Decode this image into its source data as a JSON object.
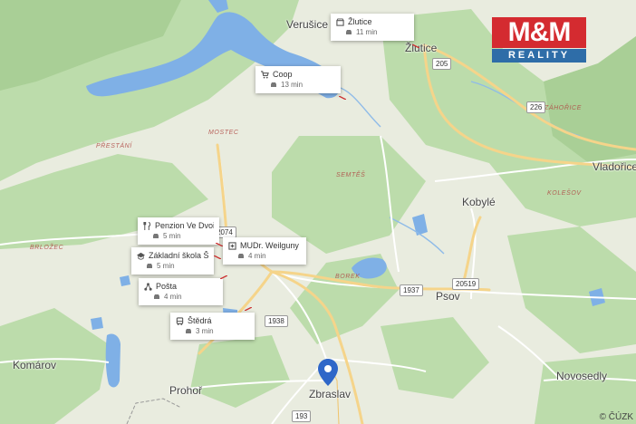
{
  "places": {
    "verusice": "Verušice",
    "zlutice": "Žlutice",
    "vladorice": "Vladořice",
    "kobyle": "Kobylé",
    "psov": "Psov",
    "komarov": "Komárov",
    "prohor": "Prohoř",
    "zbraslav": "Zbraslav",
    "novosedly": "Novosedly",
    "prestani": "PŘESTÁNÍ",
    "mostec": "MOSTEC",
    "semtes": "SEMTĚŠ",
    "brlozec": "BRLOŽEC",
    "borek": "BOREK",
    "zahorice": "ZÁHOŘICE",
    "kolesov": "KOLEŠOV"
  },
  "roads": [
    "205",
    "226",
    "1937",
    "20519",
    "1938",
    "193",
    "2074"
  ],
  "pois": [
    {
      "icon": "shop-icon",
      "name": "Žlutice",
      "time": "11 min"
    },
    {
      "icon": "cart-icon",
      "name": "Coop",
      "time": "13 min"
    },
    {
      "icon": "restaurant-icon",
      "name": "Penzion Ve Dvoře...",
      "time": "5 min"
    },
    {
      "icon": "school-icon",
      "name": "Základní škola Št...",
      "time": "5 min"
    },
    {
      "icon": "medical-icon",
      "name": "MUDr. Weilguny Iva",
      "time": "4 min"
    },
    {
      "icon": "post-icon",
      "name": "Pošta",
      "time": "4 min"
    },
    {
      "icon": "bus-icon",
      "name": "Štědrá",
      "time": "3 min"
    }
  ],
  "logo": {
    "top": "M&M",
    "bottom": "REALITY"
  },
  "attribution": "© ČÚZK",
  "colors": {
    "water": "#7fb0e6",
    "forest": "#bcdcab",
    "field": "#e9ecdf",
    "road": "#f5d48a",
    "logo_red": "#d42b30",
    "logo_blue": "#2e6da8"
  }
}
